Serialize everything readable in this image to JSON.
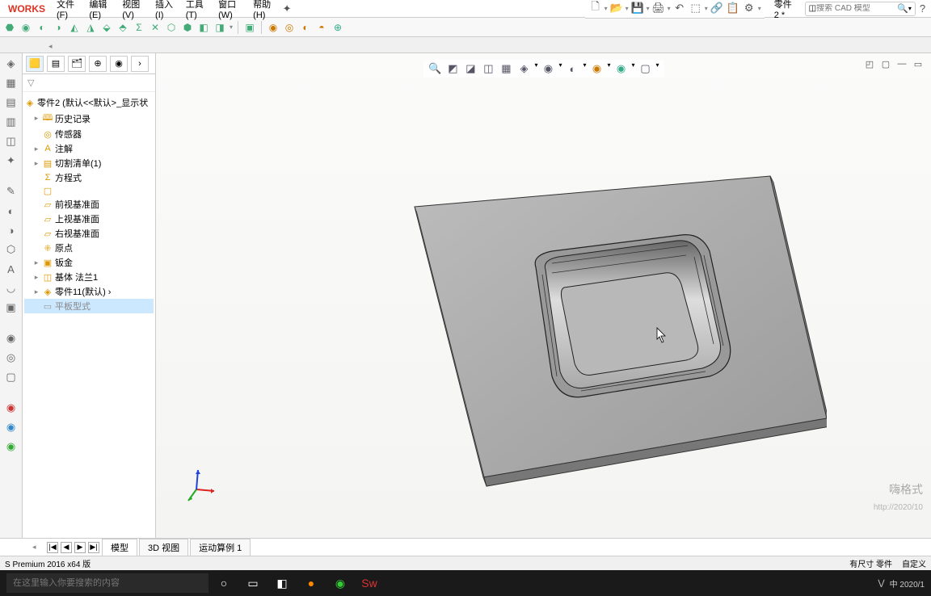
{
  "app": {
    "logo": "WORKS",
    "doc_title": "零件2 *",
    "search_placeholder": "搜索 CAD 模型"
  },
  "menus": [
    "文件(F)",
    "编辑(E)",
    "视图(V)",
    "插入(I)",
    "工具(T)",
    "窗口(W)",
    "帮助(H)"
  ],
  "tree": {
    "root": "零件2 (默认<<默认>_显示状",
    "items": [
      "历史记录",
      "传感器",
      "注解",
      "切割清单(1)",
      "方程式",
      "",
      "前视基准面",
      "上视基准面",
      "右视基准面",
      "原点",
      "钣金",
      "基体 法兰1",
      "零件11(默认) ›",
      "平板型式"
    ]
  },
  "bottom_tabs": {
    "nav": [
      "|◀",
      "◀",
      "▶",
      "▶|"
    ],
    "tabs": [
      "模型",
      "3D 视图",
      "运动算例 1"
    ]
  },
  "status": {
    "left": "S Premium 2016 x64 版",
    "right": [
      "有尺寸 零件",
      "自定义"
    ]
  },
  "taskbar": {
    "search_placeholder": "在这里输入你要搜索的内容",
    "tray_text": "中 2020/1"
  },
  "watermark": {
    "line1": "嗨格式",
    "line2": "http://2020/10"
  }
}
